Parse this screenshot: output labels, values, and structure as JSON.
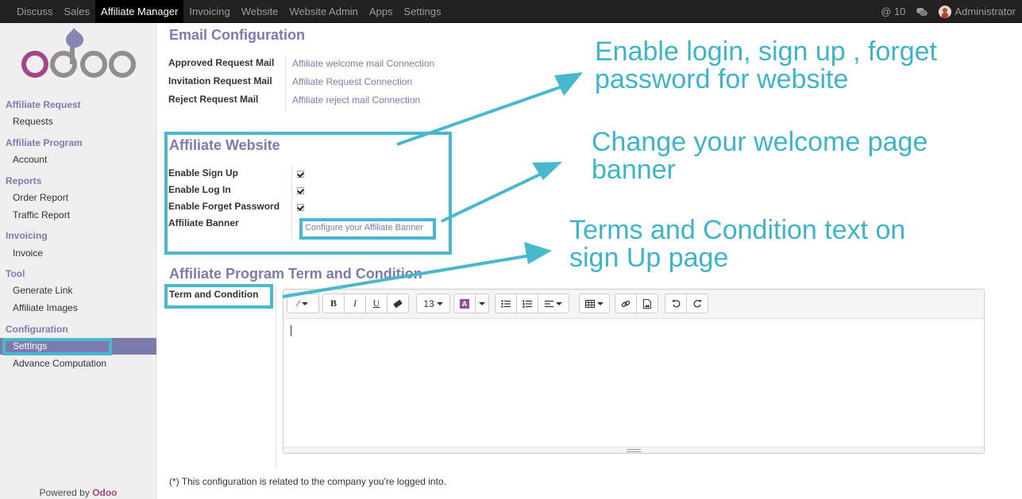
{
  "topbar": {
    "menu": [
      "Discuss",
      "Sales",
      "Affiliate Manager",
      "Invoicing",
      "Website",
      "Website Admin",
      "Apps",
      "Settings"
    ],
    "active_menu": "Affiliate Manager",
    "notifications": "@ 10",
    "user": "Administrator"
  },
  "sidebar": {
    "sections": [
      {
        "title": "Affiliate Request",
        "items": [
          "Requests"
        ]
      },
      {
        "title": "Affiliate Program",
        "items": [
          "Account"
        ]
      },
      {
        "title": "Reports",
        "items": [
          "Order Report",
          "Traffic Report"
        ]
      },
      {
        "title": "Invoicing",
        "items": [
          "Invoice"
        ]
      },
      {
        "title": "Tool",
        "items": [
          "Generate Link",
          "Affiliate Images"
        ]
      },
      {
        "title": "Configuration",
        "items": [
          "Settings",
          "Advance Computation"
        ]
      }
    ],
    "active_item": "Settings",
    "powered_prefix": "Powered by",
    "powered_brand": "Odoo"
  },
  "email_config": {
    "title": "Email Configuration",
    "rows": [
      {
        "label": "Approved Request Mail",
        "value": "Affiliate welcome mail Connection"
      },
      {
        "label": "Invitation Request Mail",
        "value": "Affiliate Request Connection"
      },
      {
        "label": "Reject Request Mail",
        "value": "Affiliate reject mail Connection"
      }
    ]
  },
  "affiliate_website": {
    "title": "Affiliate Website",
    "checkboxes": [
      {
        "label": "Enable Sign Up",
        "checked": true
      },
      {
        "label": "Enable Log In",
        "checked": true
      },
      {
        "label": "Enable Forget Password",
        "checked": true
      }
    ],
    "banner_label": "Affiliate Banner",
    "banner_link": "Configure your Affiliate Banner"
  },
  "terms": {
    "title": "Affiliate Program Term and Condition",
    "label": "Term and Condition",
    "font_size": "13"
  },
  "footnote": "(*) This configuration is related to the company you're logged into.",
  "annotations": {
    "a1_line1": "Enable login, sign up , forget",
    "a1_line2": "password for website",
    "a2_line1": "Change your welcome page",
    "a2_line2": "banner",
    "a3_line1": "Terms and Condition text on",
    "a3_line2": "sign Up page"
  },
  "colors": {
    "accent": "#7c7bad",
    "highlight": "#49b8cc",
    "topbar": "#212121"
  }
}
